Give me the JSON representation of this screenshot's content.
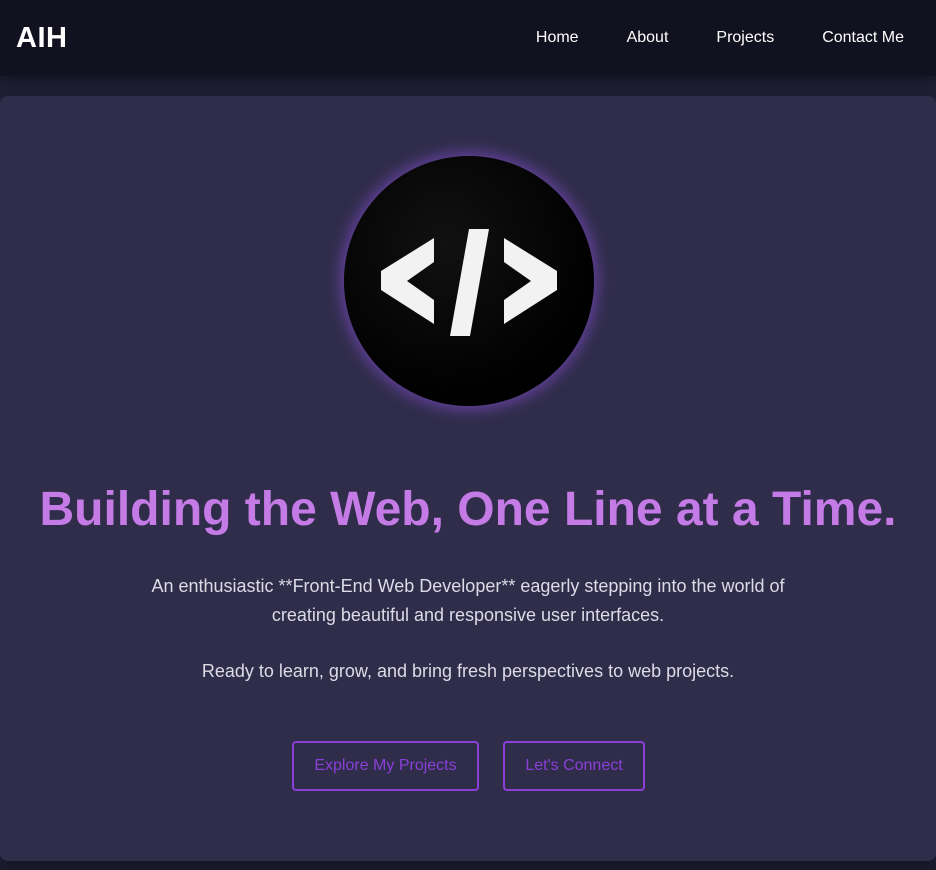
{
  "header": {
    "logo": "AIH",
    "nav": [
      {
        "label": "Home"
      },
      {
        "label": "About"
      },
      {
        "label": "Projects"
      },
      {
        "label": "Contact Me"
      }
    ]
  },
  "hero": {
    "avatar_icon": "code-brackets-icon",
    "headline": "Building the Web, One Line at a Time.",
    "intro": "An enthusiastic **Front-End Web Developer** eagerly stepping into the world of creating beautiful and responsive user interfaces.",
    "intro_secondary": "Ready to learn, grow, and bring fresh perspectives to web projects.",
    "buttons": {
      "projects": "Explore My Projects",
      "connect": "Let's Connect"
    }
  },
  "colors": {
    "page_bg": "#1f1e33",
    "nav_bg": "#11111f",
    "card_bg": "#302d4b",
    "headline": "#c57be6",
    "accent": "#8a3fd9",
    "body_text": "#dcdbe6"
  }
}
